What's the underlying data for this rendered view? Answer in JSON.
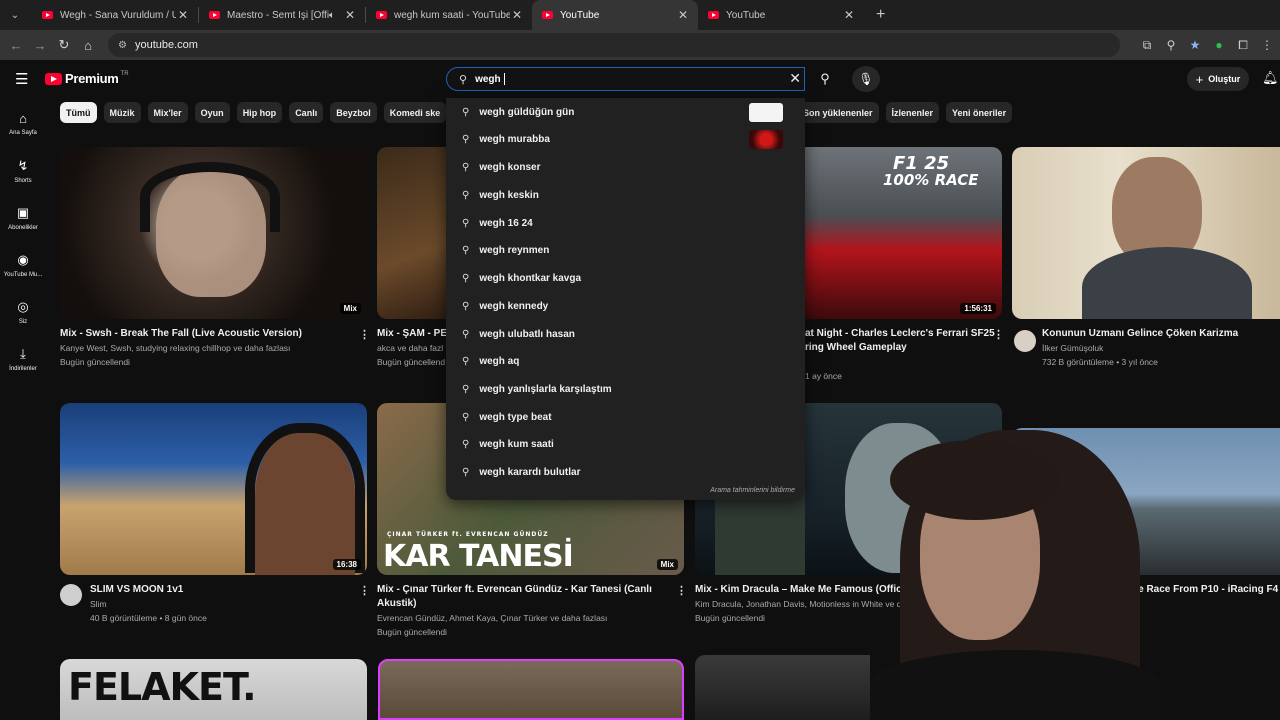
{
  "browser": {
    "tabs": [
      {
        "title": "Wegh - Sana Vuruldum / Uluba",
        "active": false,
        "audio": false
      },
      {
        "title": "Maestro - Semt İşi [Official",
        "active": false,
        "audio": true
      },
      {
        "title": "wegh kum saati - YouTube",
        "active": false,
        "audio": false
      },
      {
        "title": "YouTube",
        "active": true,
        "audio": false
      },
      {
        "title": "YouTube",
        "active": false,
        "audio": false
      }
    ],
    "url": "youtube.com"
  },
  "header": {
    "logo": "Premium",
    "region": "TR",
    "search_value": "wegh",
    "create_label": "Oluştur"
  },
  "sidebar": {
    "items": [
      {
        "label": "Ana Sayfa",
        "icon": "home-icon"
      },
      {
        "label": "Shorts",
        "icon": "shorts-icon"
      },
      {
        "label": "Abonelikler",
        "icon": "subscriptions-icon"
      },
      {
        "label": "YouTube Mu...",
        "icon": "youtube-music-icon"
      },
      {
        "label": "Siz",
        "icon": "you-icon"
      },
      {
        "label": "İndirilenler",
        "icon": "download-icon"
      }
    ]
  },
  "chips": [
    "Tümü",
    "Müzik",
    "Mix'ler",
    "Oyun",
    "Hip hop",
    "Canlı",
    "Beyzbol",
    "Komedi ske"
  ],
  "chips_right": [
    "Son yüklenenler",
    "İzlenenler",
    "Yeni öneriler"
  ],
  "suggestions": {
    "items": [
      "wegh güldüğün gün",
      "wegh murabba",
      "wegh konser",
      "wegh keskin",
      "wegh 16 24",
      "wegh reynmen",
      "wegh khontkar kavga",
      "wegh kennedy",
      "wegh ulubatlı hasan",
      "wegh aq",
      "wegh yanlışlarla karşılaştım",
      "wegh type beat",
      "wegh kum saati",
      "wegh karardı bulutlar"
    ],
    "report": "Arama tahminlerini bildirme"
  },
  "videos": {
    "r1c1": {
      "title": "Mix - Swsh - Break The Fall (Live Acoustic Version)",
      "meta1": "Kanye West, Swsh, studying relaxing chillhop ve daha fazlası",
      "meta2": "Bugün güncellendi",
      "badge": "Mix"
    },
    "r1c2": {
      "title": "Mix - ŞAM - PE",
      "meta1": "akca ve daha fazl",
      "meta2": "Bugün güncellend"
    },
    "r1c3": {
      "title": "at Night - Charles Leclerc's Ferrari SF25",
      "title2": "ring Wheel Gameplay",
      "meta2": "1 ay önce",
      "duration": "1:56:31",
      "thumb_title": "F1 25",
      "thumb_sub": "100% RACE"
    },
    "r1c4": {
      "title": "Konunun Uzmanı Gelince Çöken Karizma",
      "meta1": "İlker Gümüşoluk",
      "meta2": "732 B görüntüleme • 3 yıl önce"
    },
    "r2c1": {
      "title": "SLIM VS MOON 1v1",
      "meta1": "Slim",
      "meta2": "40 B görüntüleme • 8 gün önce",
      "duration": "16:38"
    },
    "r2c2": {
      "title": "Mix - Çınar Türker ft. Evrencan Gündüz - Kar Tanesi (Canlı",
      "title2": "Akustik)",
      "meta1": "Evrencan Gündüz, Ahmet Kaya, Çınar Türker ve daha fazlası",
      "meta2": "Bugün güncellendi",
      "badge": "Mix",
      "thumb_title": "KAR TANESİ",
      "thumb_sub": "ÇINAR TÜRKER ft. EVRENCAN GÜNDÜZ"
    },
    "r2c3": {
      "title": "Mix - Kim Dracula – Make Me Famous (Official Vid",
      "meta1": "Kim Dracula, Jonathan Davis, Motionless in White ve d",
      "meta2": "Bugün güncellendi"
    },
    "r2c4": {
      "title": "ne Race From P10 - iRacing F4"
    },
    "r3c1": {
      "thumb_title": "FELAKET."
    }
  },
  "colors": {
    "accent": "#ff0033",
    "search_border": "#1c62b9",
    "background": "#0f0f0f"
  }
}
